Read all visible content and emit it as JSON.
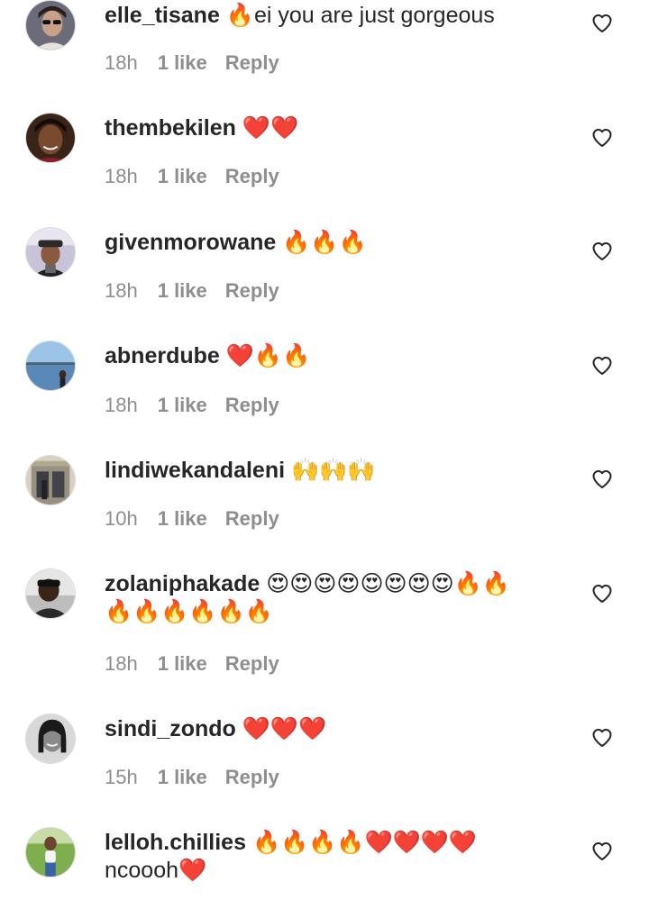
{
  "comments": [
    {
      "username": "elle_tisane",
      "text_lines": [
        "🔥ei you are just gorgeous"
      ],
      "time": "18h",
      "likes": "1 like",
      "reply": "Reply",
      "avatar_icon": "avatar-woman-sunglasses",
      "avatar_color": "#6b6b7a"
    },
    {
      "username": "thembekilen",
      "text_lines": [
        "❤️❤️"
      ],
      "time": "18h",
      "likes": "1 like",
      "reply": "Reply",
      "avatar_icon": "avatar-woman-smiling",
      "avatar_color": "#3a2418"
    },
    {
      "username": "givenmorowane",
      "text_lines": [
        "🔥🔥🔥"
      ],
      "time": "18h",
      "likes": "1 like",
      "reply": "Reply",
      "avatar_icon": "avatar-man-hat",
      "avatar_color": "#c9c3d8"
    },
    {
      "username": "abnerdube",
      "text_lines": [
        "❤️🔥🔥"
      ],
      "time": "18h",
      "likes": "1 like",
      "reply": "Reply",
      "avatar_icon": "avatar-sea-landscape",
      "avatar_color": "#5a88b8"
    },
    {
      "username": "lindiwekandaleni",
      "text_lines": [
        "🙌🙌🙌"
      ],
      "time": "10h",
      "likes": "1 like",
      "reply": "Reply",
      "avatar_icon": "avatar-building-entrance",
      "avatar_color": "#9a9080"
    },
    {
      "username": "zolaniphakade",
      "text_lines": [
        "😍😍😍😍😍😍😍😍🔥🔥",
        "🔥🔥🔥🔥🔥🔥"
      ],
      "time": "18h",
      "likes": "1 like",
      "reply": "Reply",
      "avatar_icon": "avatar-man-dark",
      "avatar_color": "#2a2a2a"
    },
    {
      "username": "sindi_zondo",
      "text_lines": [
        "❤️❤️❤️"
      ],
      "time": "15h",
      "likes": "1 like",
      "reply": "Reply",
      "avatar_icon": "avatar-woman-bw",
      "avatar_color": "#d8d8d8"
    },
    {
      "username": "lelloh.chillies",
      "text_lines": [
        "🔥🔥🔥🔥❤️❤️❤️❤️",
        "ncoooh❤️"
      ],
      "time": "",
      "likes": "",
      "reply": "",
      "avatar_icon": "avatar-woman-outdoor",
      "avatar_color": "#7fae4f"
    }
  ],
  "icons": {
    "like": "heart-outline-icon"
  },
  "colors": {
    "text": "#262626",
    "meta": "#8e8e8e",
    "heart_outline": "#262626"
  }
}
